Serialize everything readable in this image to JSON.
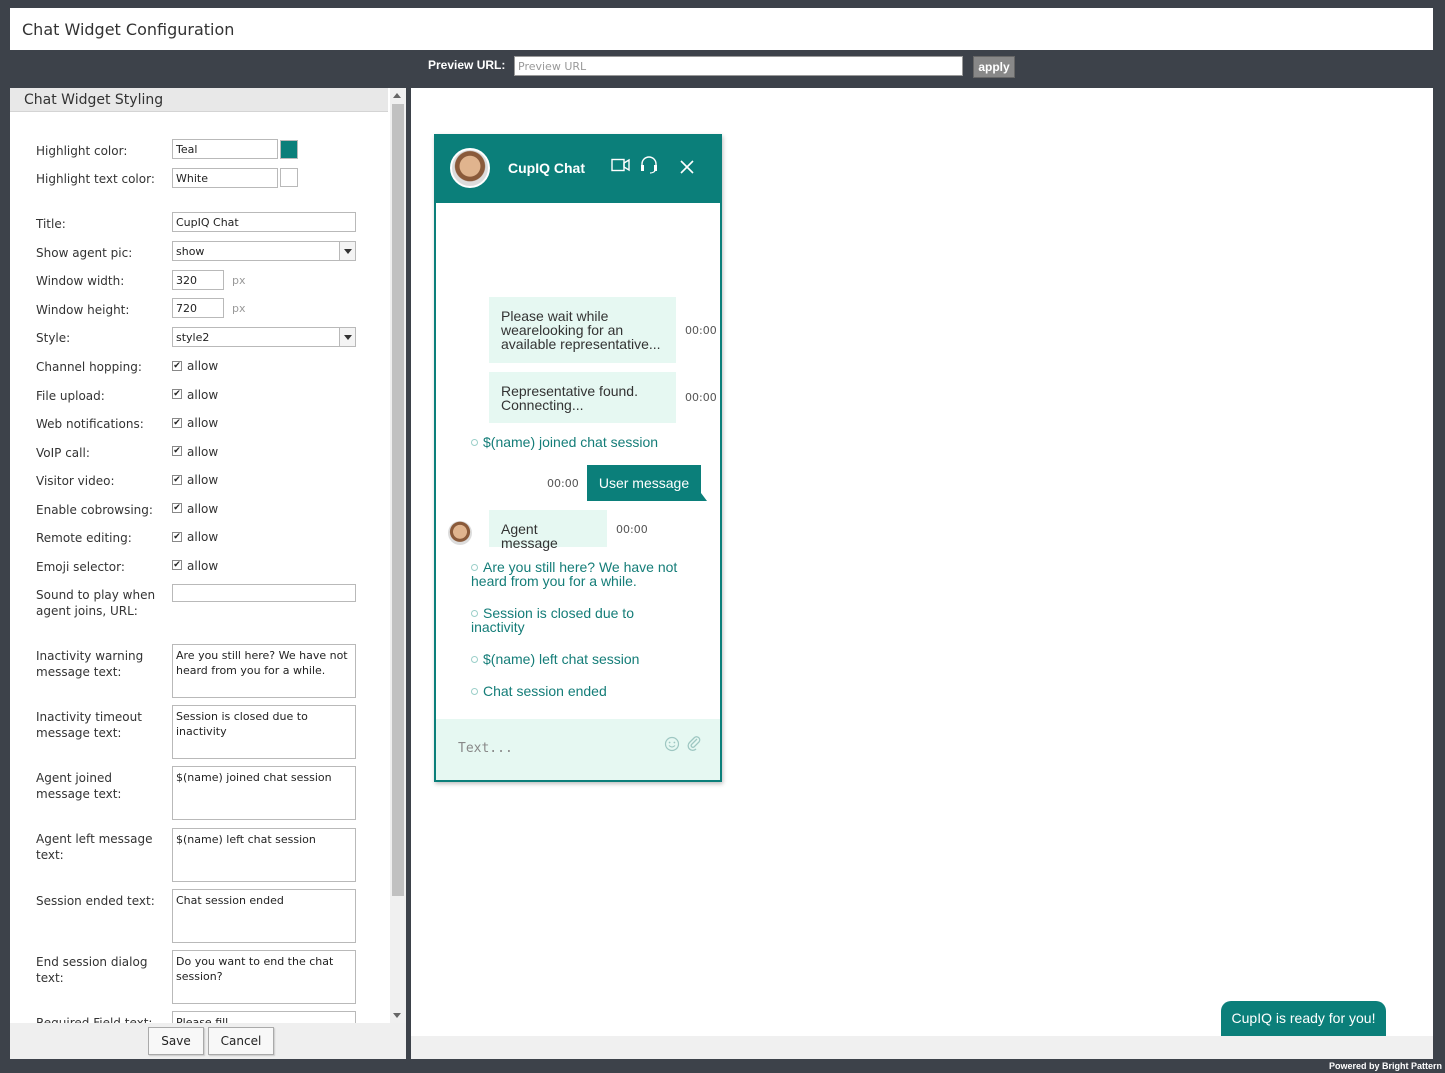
{
  "window": {
    "title": "Chat Widget Configuration"
  },
  "left": {
    "section_title": "Chat Widget Styling",
    "fields": {
      "highlight_color": {
        "label": "Highlight color:",
        "value": "Teal",
        "swatch": "#0b7f7a"
      },
      "highlight_text_color": {
        "label": "Highlight text color:",
        "value": "White",
        "swatch": "#ffffff"
      },
      "title": {
        "label": "Title:",
        "value": "CupIQ Chat"
      },
      "show_agent_pic": {
        "label": "Show agent pic:",
        "value": "show"
      },
      "window_width": {
        "label": "Window width:",
        "value": "320",
        "unit": "px"
      },
      "window_height": {
        "label": "Window height:",
        "value": "720",
        "unit": "px"
      },
      "style": {
        "label": "Style:",
        "value": "style2"
      },
      "channel_hopping": {
        "label": "Channel hopping:",
        "value": "allow"
      },
      "file_upload": {
        "label": "File upload:",
        "value": "allow"
      },
      "web_notifications": {
        "label": "Web notifications:",
        "value": "allow"
      },
      "voip_call": {
        "label": "VoIP call:",
        "value": "allow"
      },
      "visitor_video": {
        "label": "Visitor video:",
        "value": "allow"
      },
      "enable_cobrowsing": {
        "label": "Enable cobrowsing:",
        "value": "allow"
      },
      "remote_editing": {
        "label": "Remote editing:",
        "value": "allow"
      },
      "emoji_selector": {
        "label": "Emoji selector:",
        "value": "allow"
      },
      "sound_url": {
        "label": "Sound to play when agent joins, URL:",
        "value": ""
      },
      "inactivity_warning": {
        "label": "Inactivity warning message text:",
        "value": "Are you still here? We have not heard from you for a while."
      },
      "inactivity_timeout": {
        "label": "Inactivity timeout message text:",
        "value": "Session is closed due to inactivity"
      },
      "agent_joined": {
        "label": "Agent joined message text:",
        "value": "$(name) joined chat session"
      },
      "agent_left": {
        "label": "Agent left message text:",
        "value": "$(name) left chat session"
      },
      "session_ended": {
        "label": "Session ended text:",
        "value": "Chat session ended"
      },
      "end_session_dialog": {
        "label": "End session dialog text:",
        "value": "Do you want to end the chat session?"
      },
      "required_field": {
        "label": "Required Field text:",
        "value": "Please fill"
      }
    },
    "save_label": "Save",
    "cancel_label": "Cancel"
  },
  "preview_bar": {
    "label": "Preview URL:",
    "placeholder": "Preview URL",
    "apply_label": "apply"
  },
  "chat": {
    "title": "CupIQ Chat",
    "accent": "#0b7f7a",
    "header_icons": [
      "video-icon",
      "headset-icon",
      "close-icon"
    ],
    "messages": {
      "wait": "Please wait while wearelooking for an available representative...",
      "wait_time": "00:00",
      "found": "Representative found. Connecting...",
      "found_time": "00:00",
      "joined": "$(name) joined chat session",
      "user": "User message",
      "user_time": "00:00",
      "agent": "Agent message",
      "agent_time": "00:00",
      "still_here": "Are you still here? We have not heard from you for a while.",
      "closed": "Session is closed due to inactivity",
      "left": "$(name) left chat session",
      "ended": "Chat session ended"
    },
    "input_placeholder": "Text..."
  },
  "ready_button": "CupIQ is ready for you!",
  "powered_by": "Powered by Bright Pattern"
}
